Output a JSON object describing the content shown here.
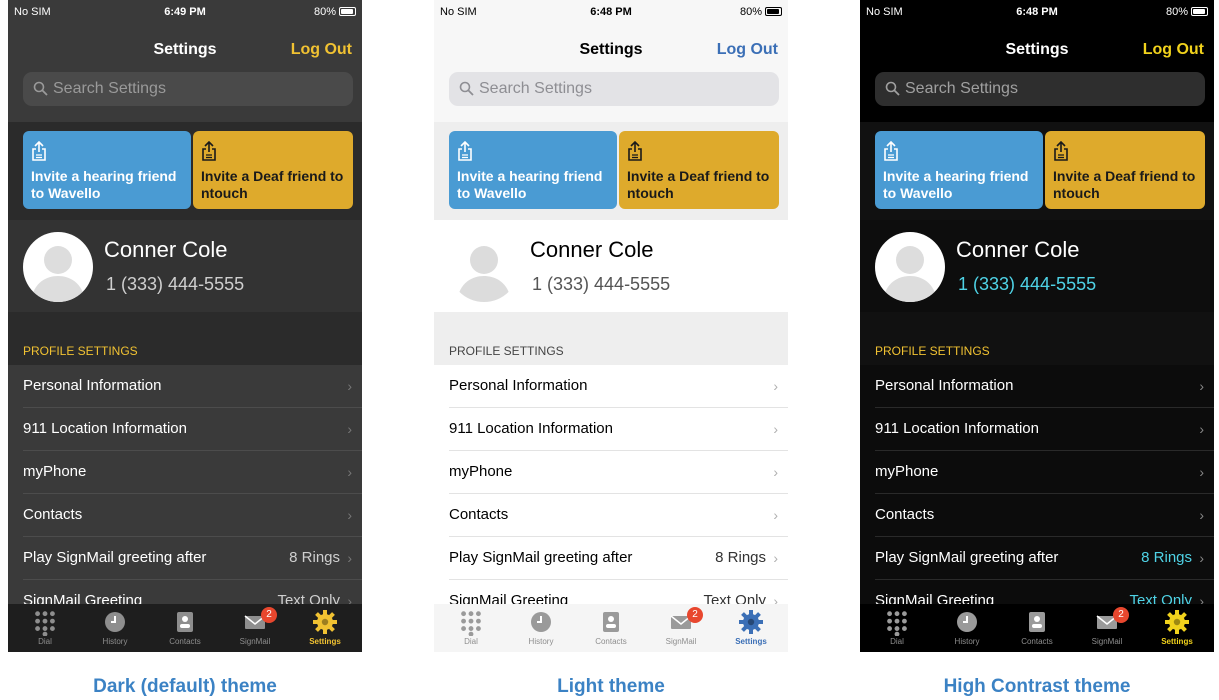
{
  "phones": [
    {
      "theme": "dark",
      "status": {
        "carrier": "No SIM",
        "time": "6:49 PM",
        "battery": "80%"
      },
      "nav": {
        "title": "Settings",
        "logout": "Log Out"
      },
      "search_placeholder": "Search Settings",
      "invite_hearing": "Invite a hearing friend to Wavello",
      "invite_deaf": "Invite a Deaf friend to ntouch",
      "profile": {
        "name": "Conner Cole",
        "phone": "1 (333) 444-5555"
      },
      "section": "PROFILE SETTINGS",
      "rows": [
        {
          "label": "Personal Information",
          "value": ""
        },
        {
          "label": "911 Location Information",
          "value": ""
        },
        {
          "label": "myPhone",
          "value": ""
        },
        {
          "label": "Contacts",
          "value": ""
        },
        {
          "label": "Play SignMail greeting after",
          "value": "8 Rings"
        },
        {
          "label": "SignMail Greeting",
          "value": "Text Only"
        }
      ],
      "tabs": [
        {
          "label": "Dial",
          "icon": "dial-icon"
        },
        {
          "label": "History",
          "icon": "history-icon"
        },
        {
          "label": "Contacts",
          "icon": "contacts-icon"
        },
        {
          "label": "SignMail",
          "icon": "signmail-icon",
          "badge": "2"
        },
        {
          "label": "Settings",
          "icon": "settings-icon",
          "active": true
        }
      ],
      "caption": "Dark (default) theme"
    },
    {
      "theme": "light",
      "status": {
        "carrier": "No SIM",
        "time": "6:48 PM",
        "battery": "80%"
      },
      "nav": {
        "title": "Settings",
        "logout": "Log Out"
      },
      "search_placeholder": "Search Settings",
      "invite_hearing": "Invite a hearing friend to Wavello",
      "invite_deaf": "Invite a Deaf friend to ntouch",
      "profile": {
        "name": "Conner Cole",
        "phone": "1 (333) 444-5555"
      },
      "section": "PROFILE SETTINGS",
      "rows": [
        {
          "label": "Personal Information",
          "value": ""
        },
        {
          "label": "911 Location Information",
          "value": ""
        },
        {
          "label": "myPhone",
          "value": ""
        },
        {
          "label": "Contacts",
          "value": ""
        },
        {
          "label": "Play SignMail greeting after",
          "value": "8 Rings"
        },
        {
          "label": "SignMail Greeting",
          "value": "Text Only"
        }
      ],
      "tabs": [
        {
          "label": "Dial",
          "icon": "dial-icon"
        },
        {
          "label": "History",
          "icon": "history-icon"
        },
        {
          "label": "Contacts",
          "icon": "contacts-icon"
        },
        {
          "label": "SignMail",
          "icon": "signmail-icon",
          "badge": "2"
        },
        {
          "label": "Settings",
          "icon": "settings-icon",
          "active": true
        }
      ],
      "caption": "Light theme"
    },
    {
      "theme": "high-contrast",
      "status": {
        "carrier": "No SIM",
        "time": "6:48 PM",
        "battery": "80%"
      },
      "nav": {
        "title": "Settings",
        "logout": "Log Out"
      },
      "search_placeholder": "Search Settings",
      "invite_hearing": "Invite a hearing friend to Wavello",
      "invite_deaf": "Invite a Deaf friend to ntouch",
      "profile": {
        "name": "Conner Cole",
        "phone": "1 (333) 444-5555"
      },
      "section": "PROFILE SETTINGS",
      "rows": [
        {
          "label": "Personal Information",
          "value": ""
        },
        {
          "label": "911 Location Information",
          "value": ""
        },
        {
          "label": "myPhone",
          "value": ""
        },
        {
          "label": "Contacts",
          "value": ""
        },
        {
          "label": "Play SignMail greeting after",
          "value": "8 Rings"
        },
        {
          "label": "SignMail Greeting",
          "value": "Text Only"
        }
      ],
      "tabs": [
        {
          "label": "Dial",
          "icon": "dial-icon"
        },
        {
          "label": "History",
          "icon": "history-icon"
        },
        {
          "label": "Contacts",
          "icon": "contacts-icon"
        },
        {
          "label": "SignMail",
          "icon": "signmail-icon",
          "badge": "2"
        },
        {
          "label": "Settings",
          "icon": "settings-icon",
          "active": true
        }
      ],
      "caption": "High Contrast theme"
    }
  ],
  "colors": {
    "caption": "#3b82c4",
    "invite_blue": "#4a9bd3",
    "invite_gold": "#deaa2c",
    "dark_bg": "#2c2c2c",
    "light_bg": "#f2f2f2",
    "hc_bg": "#000000",
    "accent_gold": "#f1c232",
    "accent_blue": "#3b6fb6",
    "hc_cyan": "#4fd3e6"
  }
}
